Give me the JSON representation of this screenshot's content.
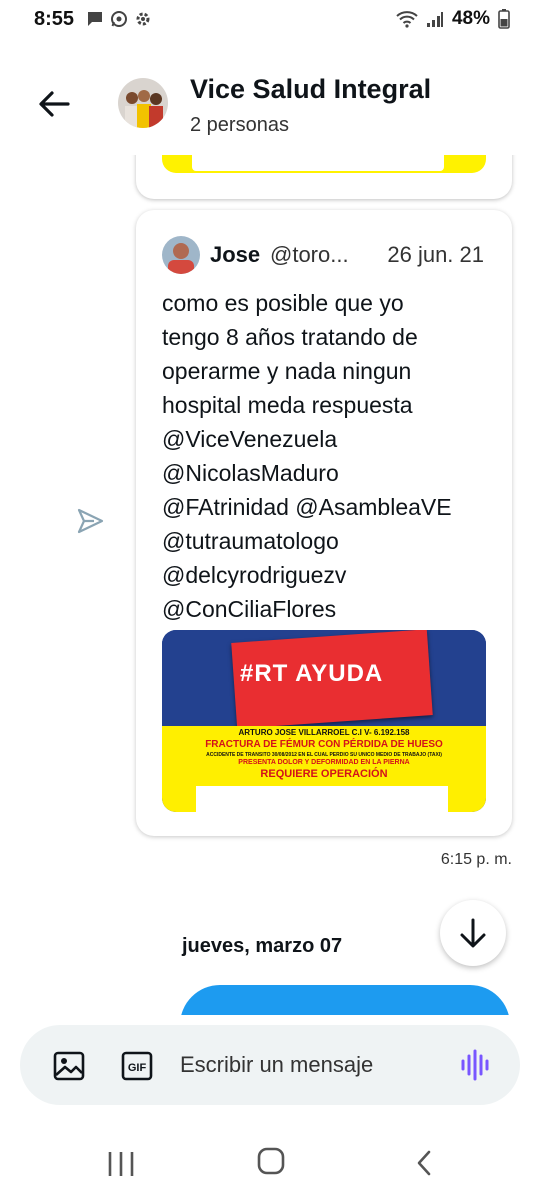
{
  "status_bar": {
    "time": "8:55",
    "battery": "48%",
    "icons": [
      "message-icon",
      "whatsapp-icon",
      "settings-icon",
      "wifi-icon",
      "signal-icon",
      "battery-icon"
    ]
  },
  "header": {
    "title": "Vice Salud Integral",
    "subtitle": "2 personas",
    "back_icon": "arrow-left-icon"
  },
  "tweet": {
    "author_name": "Jose",
    "author_handle": "@toro...",
    "date": "26 jun. 21",
    "text_lines": [
      "como es posible que yo",
      "tengo 8 años tratando de",
      "operarme y nada ningun",
      "hospital meda respuesta",
      "@ViceVenezuela",
      "@NicolasMaduro",
      "@FAtrinidad @AsambleaVE",
      "@tutraumatologo",
      "@delcyrodriguezv",
      "@ConCiliaFlores"
    ],
    "image": {
      "headline": "#RT AYUDA",
      "lines": [
        "ARTURO JOSE VILLARROEL C.I V- 6.192.158",
        "FRACTURA DE FÉMUR CON PÉRDIDA DE HUESO",
        "ACCIDENTE DE TRANSITO 30/08/2012 EN EL CUAL PERDIO SU UNICO MEDIO DE TRABAJO (TAXI)",
        "PRESENTA DOLOR Y DEFORMIDAD EN LA PIERNA",
        "REQUIERE OPERACIÓN"
      ]
    }
  },
  "message_time": "6:15 p. m.",
  "date_separator": "jueves, marzo 07",
  "composer": {
    "placeholder": "Escribir un mensaje",
    "gif_label": "GIF"
  },
  "colors": {
    "accent": "#1d9bf0",
    "composer_bg": "#eff3f4",
    "voice_icon": "#7856ff",
    "image_blue": "#23418f",
    "image_red": "#e92e31",
    "image_yellow": "#ffef00",
    "image_text_red": "#d3121a"
  }
}
